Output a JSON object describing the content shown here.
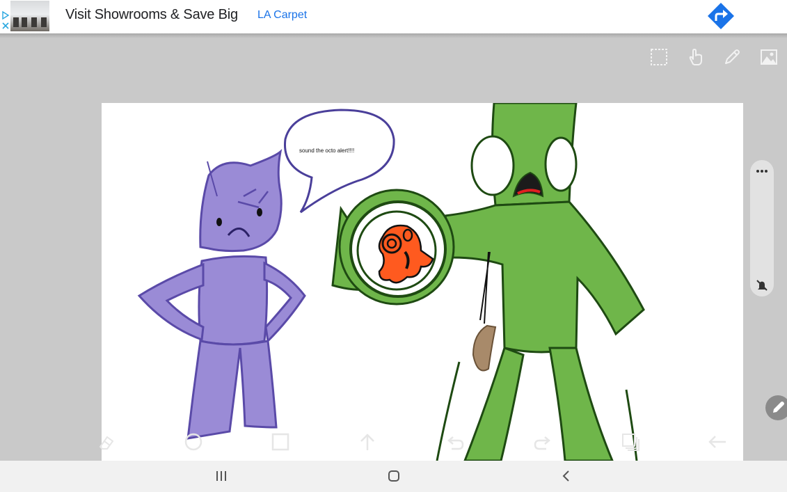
{
  "ad": {
    "title": "Visit Showrooms & Save Big",
    "brand": "LA Carpet",
    "badge_icons": [
      "play-triangle-icon",
      "close-x-icon"
    ],
    "action_icon": "directions-arrow-icon",
    "action_color": "#1a73e8"
  },
  "toolbar_top": {
    "items": [
      {
        "name": "selection-tool",
        "icon": "dashed-rectangle-icon"
      },
      {
        "name": "touch-draw-toggle",
        "icon": "hand-pointer-icon"
      },
      {
        "name": "pen-tool",
        "icon": "pencil-icon"
      },
      {
        "name": "insert-image",
        "icon": "image-icon"
      }
    ]
  },
  "canvas": {
    "speech_bubble_text": "sound the octo alert!!!!"
  },
  "side_panel": {
    "more_icon": "more-dots-icon",
    "bell_icon": "bell-off-icon"
  },
  "pen_fab_icon": "pencil-icon",
  "toolbar_bottom": {
    "items": [
      {
        "name": "eraser-tool",
        "icon": "eraser-icon"
      },
      {
        "name": "circle-shape",
        "icon": "circle-icon"
      },
      {
        "name": "square-shape",
        "icon": "square-icon"
      },
      {
        "name": "arrow-up",
        "icon": "arrow-up-icon"
      },
      {
        "name": "undo",
        "icon": "undo-icon"
      },
      {
        "name": "redo",
        "icon": "redo-icon"
      },
      {
        "name": "layers",
        "icon": "layers-icon"
      },
      {
        "name": "back",
        "icon": "arrow-left-icon"
      }
    ]
  },
  "navbar": {
    "items": [
      "recents-icon",
      "home-icon",
      "back-chevron-icon"
    ]
  },
  "colors": {
    "purple_character": "#9a8bd6",
    "purple_outline": "#5a4aa8",
    "green_character": "#6fb64a",
    "green_outline": "#1e4a12",
    "orange_octo": "#ff5a1f"
  }
}
